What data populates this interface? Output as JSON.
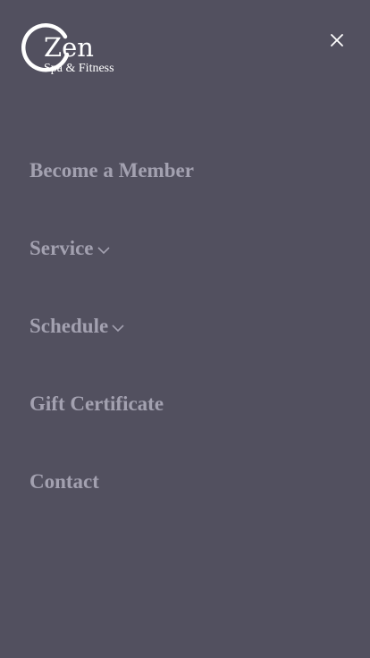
{
  "brand": {
    "name": "Zen",
    "tagline": "Spa & Fitness"
  },
  "menu": {
    "close_icon": "close-icon",
    "items": [
      {
        "label": "Become a Member",
        "has_submenu": false
      },
      {
        "label": "Service",
        "has_submenu": true
      },
      {
        "label": "Schedule",
        "has_submenu": true
      },
      {
        "label": "Gift Certificate",
        "has_submenu": false
      },
      {
        "label": "Contact",
        "has_submenu": false
      }
    ]
  },
  "colors": {
    "background": "#52505f",
    "menu_text": "#a3a1b0",
    "logo": "#ffffff"
  }
}
